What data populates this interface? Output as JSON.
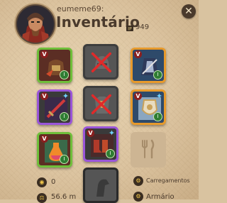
{
  "header": {
    "username": "eumeme69:",
    "title": "Inventário",
    "item_power": "949"
  },
  "slots": [
    {
      "name": "bag",
      "tier": "V",
      "quality": "green"
    },
    {
      "name": "head",
      "empty": true
    },
    {
      "name": "cape",
      "tier": "V",
      "quality": "orange"
    },
    {
      "name": "main-hand",
      "tier": "V",
      "quality": "purple"
    },
    {
      "name": "armor",
      "empty": true
    },
    {
      "name": "off-hand",
      "tier": "V",
      "quality": "orange"
    },
    {
      "name": "potion",
      "tier": "V",
      "quality": "green"
    },
    {
      "name": "shoes",
      "tier": "V",
      "quality": "purple"
    },
    {
      "name": "food",
      "empty": true
    }
  ],
  "footer": {
    "silver": "0",
    "weight": "56.6 m",
    "loadouts": "Carregamentos",
    "wardrobe": "Armário"
  }
}
